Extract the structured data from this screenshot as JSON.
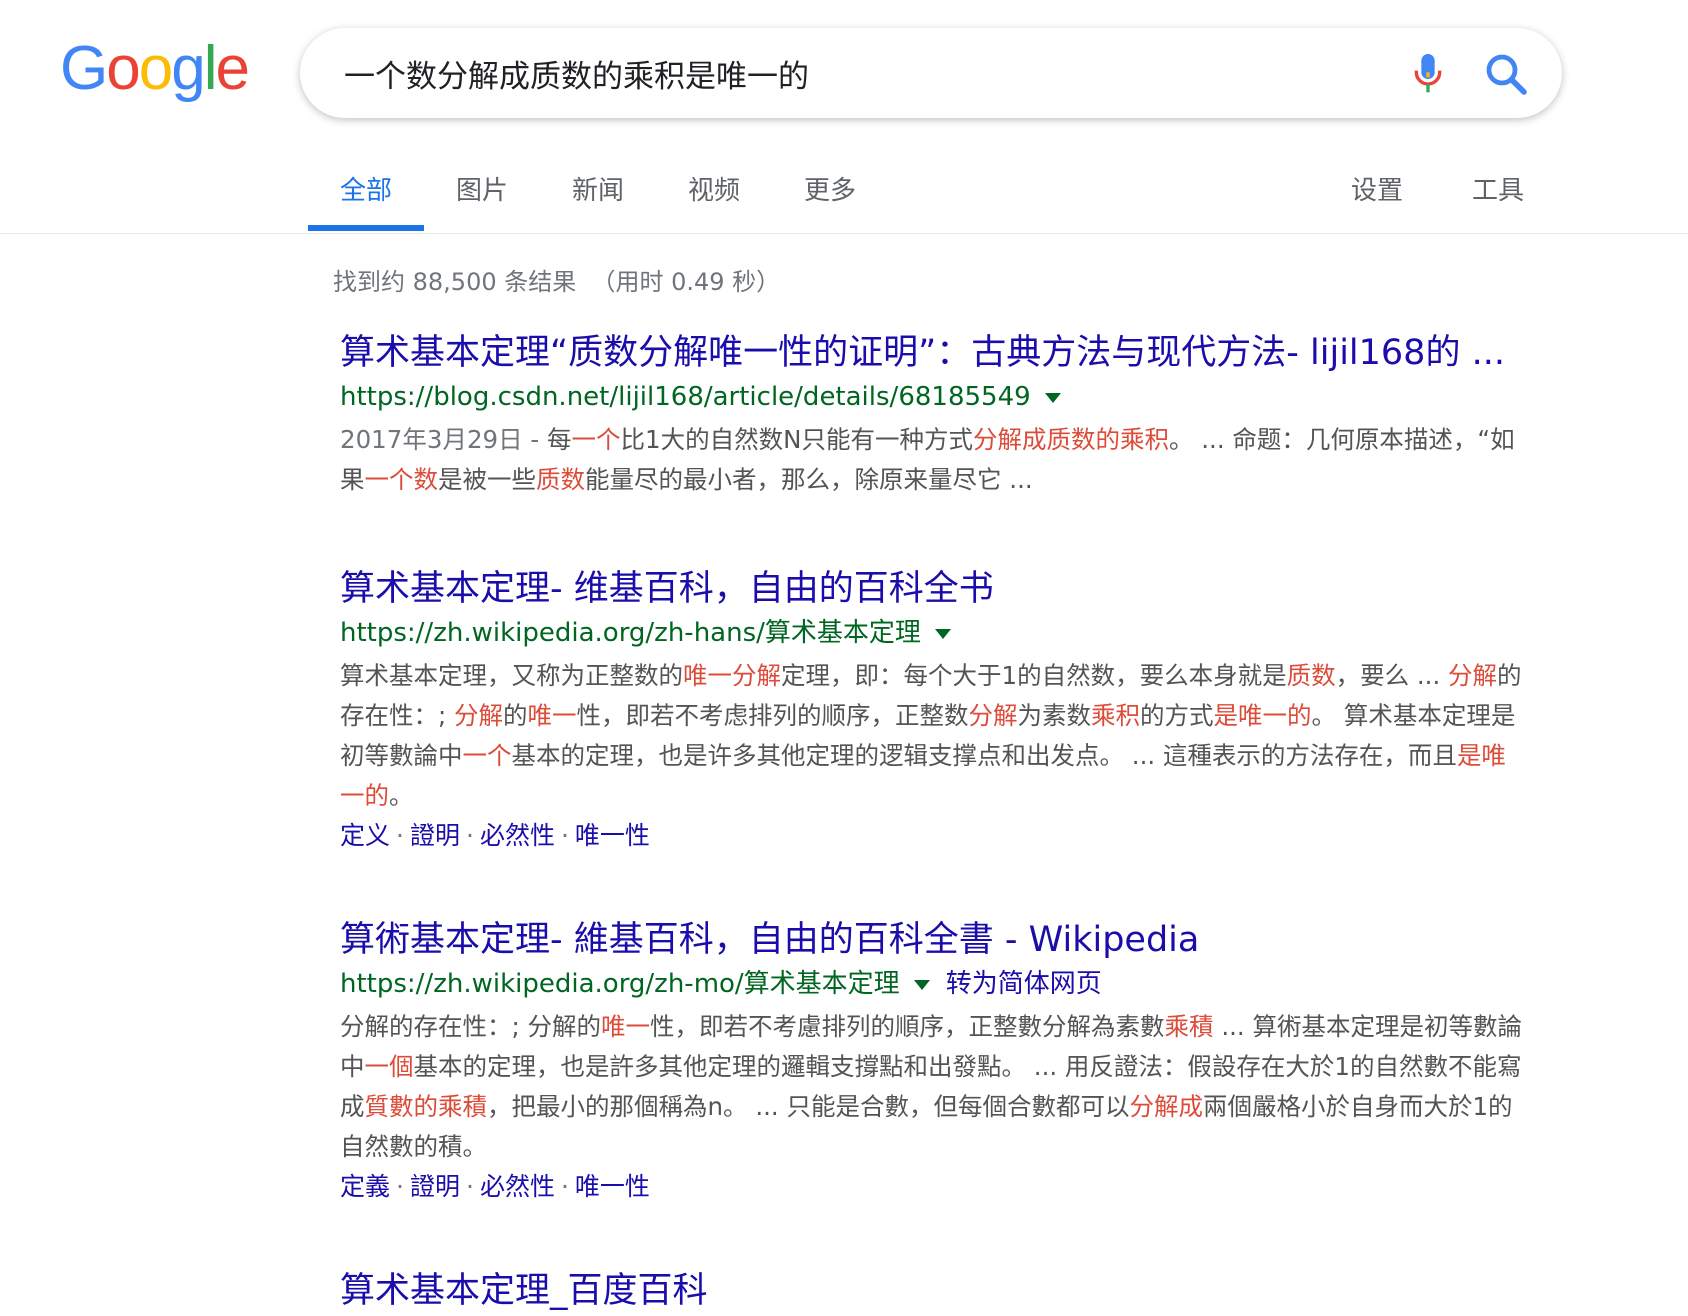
{
  "logo": {
    "letters": [
      "G",
      "o",
      "o",
      "g",
      "l",
      "e"
    ],
    "colors": [
      "#4285F4",
      "#EA4335",
      "#FBBC05",
      "#4285F4",
      "#34A853",
      "#EA4335"
    ]
  },
  "search": {
    "query": "一个数分解成质数的乘积是唯一的",
    "mic_icon": "mic-icon",
    "search_icon": "magnifier-icon"
  },
  "tabs": [
    "全部",
    "图片",
    "新闻",
    "视频",
    "更多",
    "设置",
    "工具"
  ],
  "stats": "找到约 88,500 条结果  （用时 0.49 秒）",
  "colors": {
    "accent": "#1a73e8",
    "title": "#1a0dab",
    "url": "#006621",
    "snippet": "#545454",
    "highlight": "#dd4b39"
  },
  "results": [
    {
      "title": "算术基本定理“质数分解唯一性的证明”：古典方法与现代方法- lijil168的 ...",
      "url": "https://blog.csdn.net/lijil168/article/details/68185549",
      "snippet": [
        {
          "t": "2017年3月29日 - ",
          "s": "date"
        },
        {
          "t": "每"
        },
        {
          "t": "一个",
          "s": "hl"
        },
        {
          "t": "比1大的自然数N只能有一种方式"
        },
        {
          "t": "分解成质数的乘积",
          "s": "hl"
        },
        {
          "t": "。 ... 命题：几何原本描述，“如果"
        },
        {
          "t": "一个数",
          "s": "hl"
        },
        {
          "t": "是被一些"
        },
        {
          "t": "质数",
          "s": "hl"
        },
        {
          "t": "能量尽的最小者，那么，除原来量尽它 ..."
        }
      ]
    },
    {
      "title": "算术基本定理- 维基百科，自由的百科全书",
      "url": "https://zh.wikipedia.org/zh-hans/算术基本定理",
      "snippet": [
        {
          "t": "算术基本定理，又称为正整数的"
        },
        {
          "t": "唯一分解",
          "s": "hl"
        },
        {
          "t": "定理，即：每个大于1的自然数，要么本身就是"
        },
        {
          "t": "质数",
          "s": "hl"
        },
        {
          "t": "，要么 ... "
        },
        {
          "t": "分解",
          "s": "hl"
        },
        {
          "t": "的存在性：; "
        },
        {
          "t": "分解",
          "s": "hl"
        },
        {
          "t": "的"
        },
        {
          "t": "唯一",
          "s": "hl"
        },
        {
          "t": "性，即若不考虑排列的顺序，正整数"
        },
        {
          "t": "分解",
          "s": "hl"
        },
        {
          "t": "为素数"
        },
        {
          "t": "乘积",
          "s": "hl"
        },
        {
          "t": "的方式"
        },
        {
          "t": "是唯一的",
          "s": "hl"
        },
        {
          "t": "。 算术基本定理是初等數論中"
        },
        {
          "t": "一个",
          "s": "hl"
        },
        {
          "t": "基本的定理，也是许多其他定理的逻辑支撑点和出发点。 ... 這種表示的方法存在，而且"
        },
        {
          "t": "是唯一的",
          "s": "hl"
        },
        {
          "t": "。"
        }
      ],
      "links": [
        "定义",
        "證明",
        "必然性",
        "唯一性"
      ]
    },
    {
      "title": "算術基本定理- 維基百科，自由的百科全書 - Wikipedia",
      "url": "https://zh.wikipedia.org/zh-mo/算术基本定理",
      "translate": "转为简体网页",
      "snippet": [
        {
          "t": "分解的存在性：; 分解的"
        },
        {
          "t": "唯一",
          "s": "hl"
        },
        {
          "t": "性，即若不考慮排列的順序，正整數分解為素數"
        },
        {
          "t": "乘積",
          "s": "hl"
        },
        {
          "t": " ... 算術基本定理是初等數論中"
        },
        {
          "t": "一個",
          "s": "hl"
        },
        {
          "t": "基本的定理，也是許多其他定理的邏輯支撐點和出發點。 ... 用反證法：假設存在大於1的自然數不能寫成"
        },
        {
          "t": "質數的乘積",
          "s": "hl"
        },
        {
          "t": "，把最小的那個稱為n。 ... 只能是合數，但每個合數都可以"
        },
        {
          "t": "分解成",
          "s": "hl"
        },
        {
          "t": "兩個嚴格小於自身而大於1的自然數的積。"
        }
      ],
      "links": [
        "定義",
        "證明",
        "必然性",
        "唯一性"
      ]
    },
    {
      "title": "算术基本定理_百度百科"
    }
  ]
}
